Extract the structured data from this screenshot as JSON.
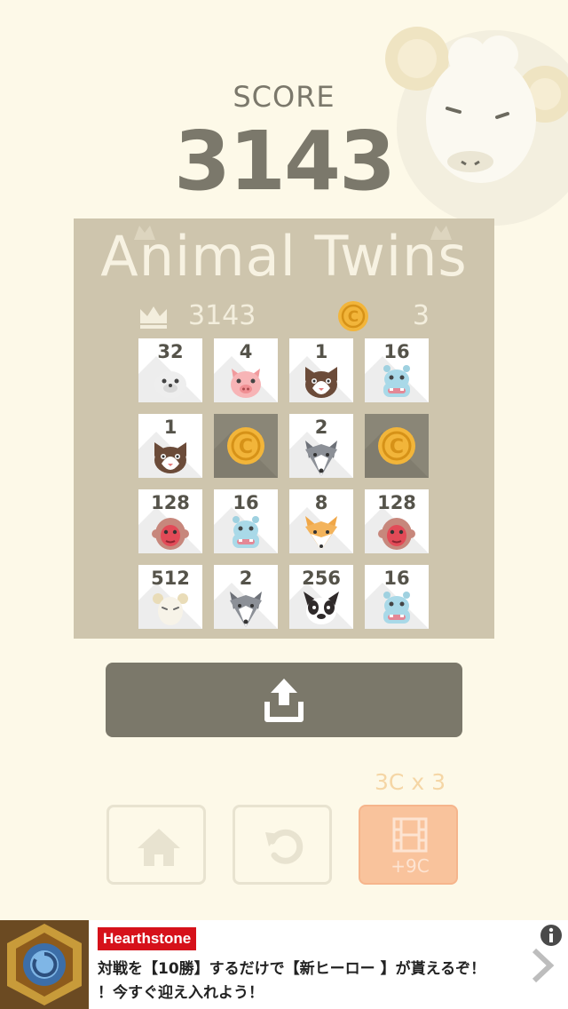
{
  "header": {
    "score_label": "SCORE",
    "score_value": "3143"
  },
  "board": {
    "title": "Animal Twins",
    "best_score": "3143",
    "coin_count": "3",
    "tiles": [
      {
        "value": "32",
        "animal": "seal-icon"
      },
      {
        "value": "4",
        "animal": "pig-icon"
      },
      {
        "value": "1",
        "animal": "cat-icon"
      },
      {
        "value": "16",
        "animal": "hippo-icon"
      },
      {
        "value": "1",
        "animal": "cat-icon"
      },
      {
        "value": "",
        "animal": "coin-icon"
      },
      {
        "value": "2",
        "animal": "wolf-icon"
      },
      {
        "value": "",
        "animal": "coin-icon"
      },
      {
        "value": "128",
        "animal": "monkey-icon"
      },
      {
        "value": "16",
        "animal": "hippo-icon"
      },
      {
        "value": "8",
        "animal": "fox-icon"
      },
      {
        "value": "128",
        "animal": "monkey-icon"
      },
      {
        "value": "512",
        "animal": "sheep-icon"
      },
      {
        "value": "2",
        "animal": "wolf-icon"
      },
      {
        "value": "256",
        "animal": "bulldog-icon"
      },
      {
        "value": "16",
        "animal": "hippo-icon"
      }
    ]
  },
  "actions": {
    "share_icon": "share-icon",
    "price_label": "3C x 3",
    "video_reward": "+9C",
    "home_icon": "home-icon",
    "retry_icon": "retry-icon",
    "video_icon": "film-icon"
  },
  "ad": {
    "brand": "Hearthstone",
    "line1": "対戦を【10勝】するだけで【新ヒーロー 】が貰えるぞ！",
    "line2": "！今すぐ迎え入れよう！"
  },
  "colors": {
    "background": "#fdf9e8",
    "board": "#cec5ad",
    "text_dark": "#7b786b",
    "coin": "#f2b53a",
    "video_button": "#f9c39c",
    "ad_brand": "#d6111a"
  }
}
